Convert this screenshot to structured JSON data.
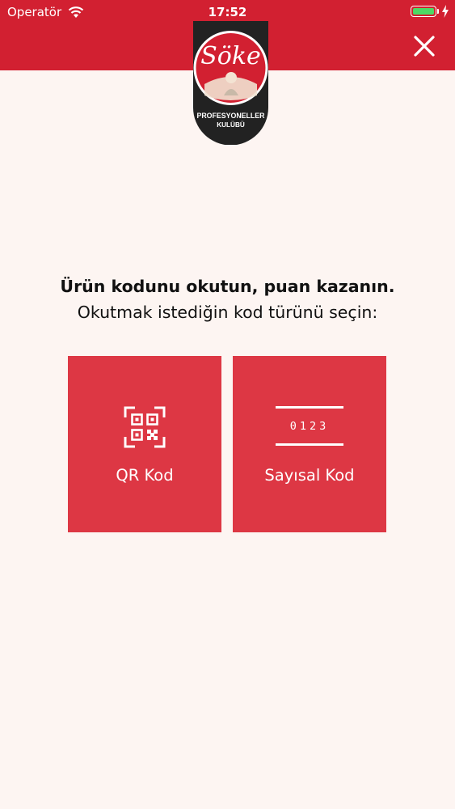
{
  "status_bar": {
    "carrier": "Operatör",
    "time": "17:52"
  },
  "header": {
    "logo": {
      "brand": "Söke",
      "line1": "PROFESYONELLER",
      "line2": "KULÜBÜ"
    },
    "close_icon": "close-icon"
  },
  "intro": {
    "title": "Ürün kodunu okutun, puan kazanın.",
    "subtitle": "Okutmak istediğin kod türünü seçin:"
  },
  "options": {
    "qr": {
      "label": "QR Kod",
      "icon": "qr-code-icon"
    },
    "numeric": {
      "label": "Sayısal Kod",
      "icon": "numeric-code-icon",
      "digits": "0123"
    }
  },
  "colors": {
    "header": "#d22031",
    "button": "#dd3744",
    "background": "#fdf5f2",
    "battery": "#4cd964"
  }
}
